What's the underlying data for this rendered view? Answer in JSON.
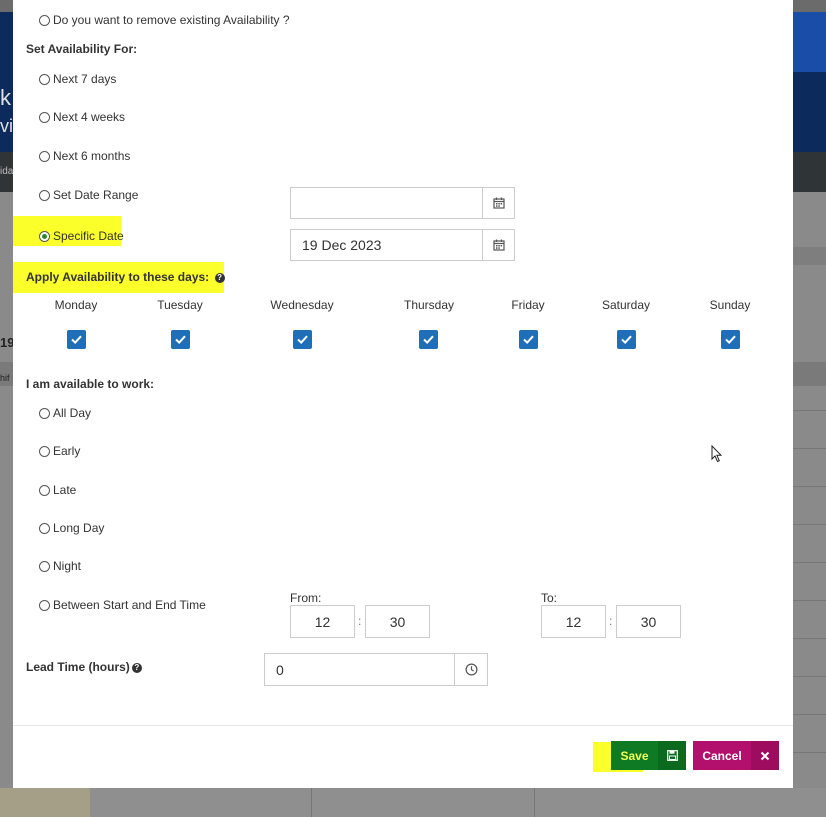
{
  "background": {
    "side_letters": [
      "k",
      "vit",
      "ida",
      "19",
      "hif"
    ]
  },
  "modal": {
    "remove_existing_label": "Do you want to remove existing Availability ?",
    "set_availability_heading": "Set Availability For:",
    "availability_options": [
      {
        "label": "Next 7 days",
        "checked": false
      },
      {
        "label": "Next 4 weeks",
        "checked": false
      },
      {
        "label": "Next 6 months",
        "checked": false
      },
      {
        "label": "Set Date Range",
        "checked": false
      },
      {
        "label": "Specific Date",
        "checked": true
      }
    ],
    "date_range_value": "",
    "specific_date_value": "19 Dec 2023",
    "apply_days_heading": "Apply Availability to these days:",
    "days": [
      {
        "label": "Monday",
        "checked": true
      },
      {
        "label": "Tuesday",
        "checked": true
      },
      {
        "label": "Wednesday",
        "checked": true
      },
      {
        "label": "Thursday",
        "checked": true
      },
      {
        "label": "Friday",
        "checked": true
      },
      {
        "label": "Saturday",
        "checked": true
      },
      {
        "label": "Sunday",
        "checked": true
      }
    ],
    "available_heading": "I am available to work:",
    "work_options": [
      {
        "label": "All Day",
        "checked": false
      },
      {
        "label": "Early",
        "checked": false
      },
      {
        "label": "Late",
        "checked": false
      },
      {
        "label": "Long Day",
        "checked": false
      },
      {
        "label": "Night",
        "checked": false
      },
      {
        "label": "Between Start and End Time",
        "checked": false
      }
    ],
    "from_label": "From:",
    "to_label": "To:",
    "from_hour": "12",
    "from_minute": "30",
    "to_hour": "12",
    "to_minute": "30",
    "time_separator": ":",
    "lead_time_label": "Lead Time (hours)",
    "lead_time_value": "0",
    "save_label": "Save",
    "cancel_label": "Cancel"
  },
  "colors": {
    "highlight": "#fbff2a",
    "save_green": "#0e7a23",
    "cancel_magenta": "#b3106e",
    "checkbox_blue": "#1f6fb8"
  }
}
